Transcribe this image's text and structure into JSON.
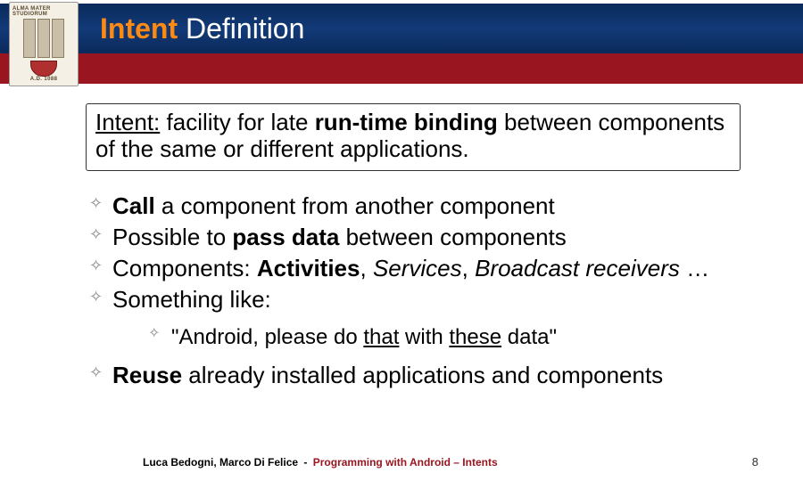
{
  "logo": {
    "top_text": "ALMA MATER STUDIORUM",
    "bottom_text": "A.D. 1088"
  },
  "header": {
    "title_accent": "Intent",
    "title_rest": " Definition"
  },
  "definition": {
    "intent_label": "Intent:",
    "pre": " facility for late ",
    "bold": "run-time binding",
    "post": " between components of the same or different applications."
  },
  "bullets": {
    "b1_bold": "Call",
    "b1_rest": " a component from another component",
    "b2_pre": "Possible to ",
    "b2_bold": "pass data",
    "b2_rest": " between components",
    "b3_pre": "Components: ",
    "b3_bold": "Activities",
    "b3_sep": ", ",
    "b3_i1": "Services",
    "b3_sep2": ", ",
    "b3_i2": "Broadcast receivers",
    "b3_dots": " …",
    "b4": "Something like:",
    "b4_sub_pre": "\"Android, please do ",
    "b4_sub_u1": "that",
    "b4_sub_mid": " with ",
    "b4_sub_u2": "these",
    "b4_sub_post": " data\"",
    "b5_bold": "Reuse",
    "b5_rest": " already installed applications and components"
  },
  "footer": {
    "authors": "Luca Bedogni, Marco Di Felice",
    "separator": "-",
    "course": "Programming with Android – Intents",
    "page": "8"
  }
}
